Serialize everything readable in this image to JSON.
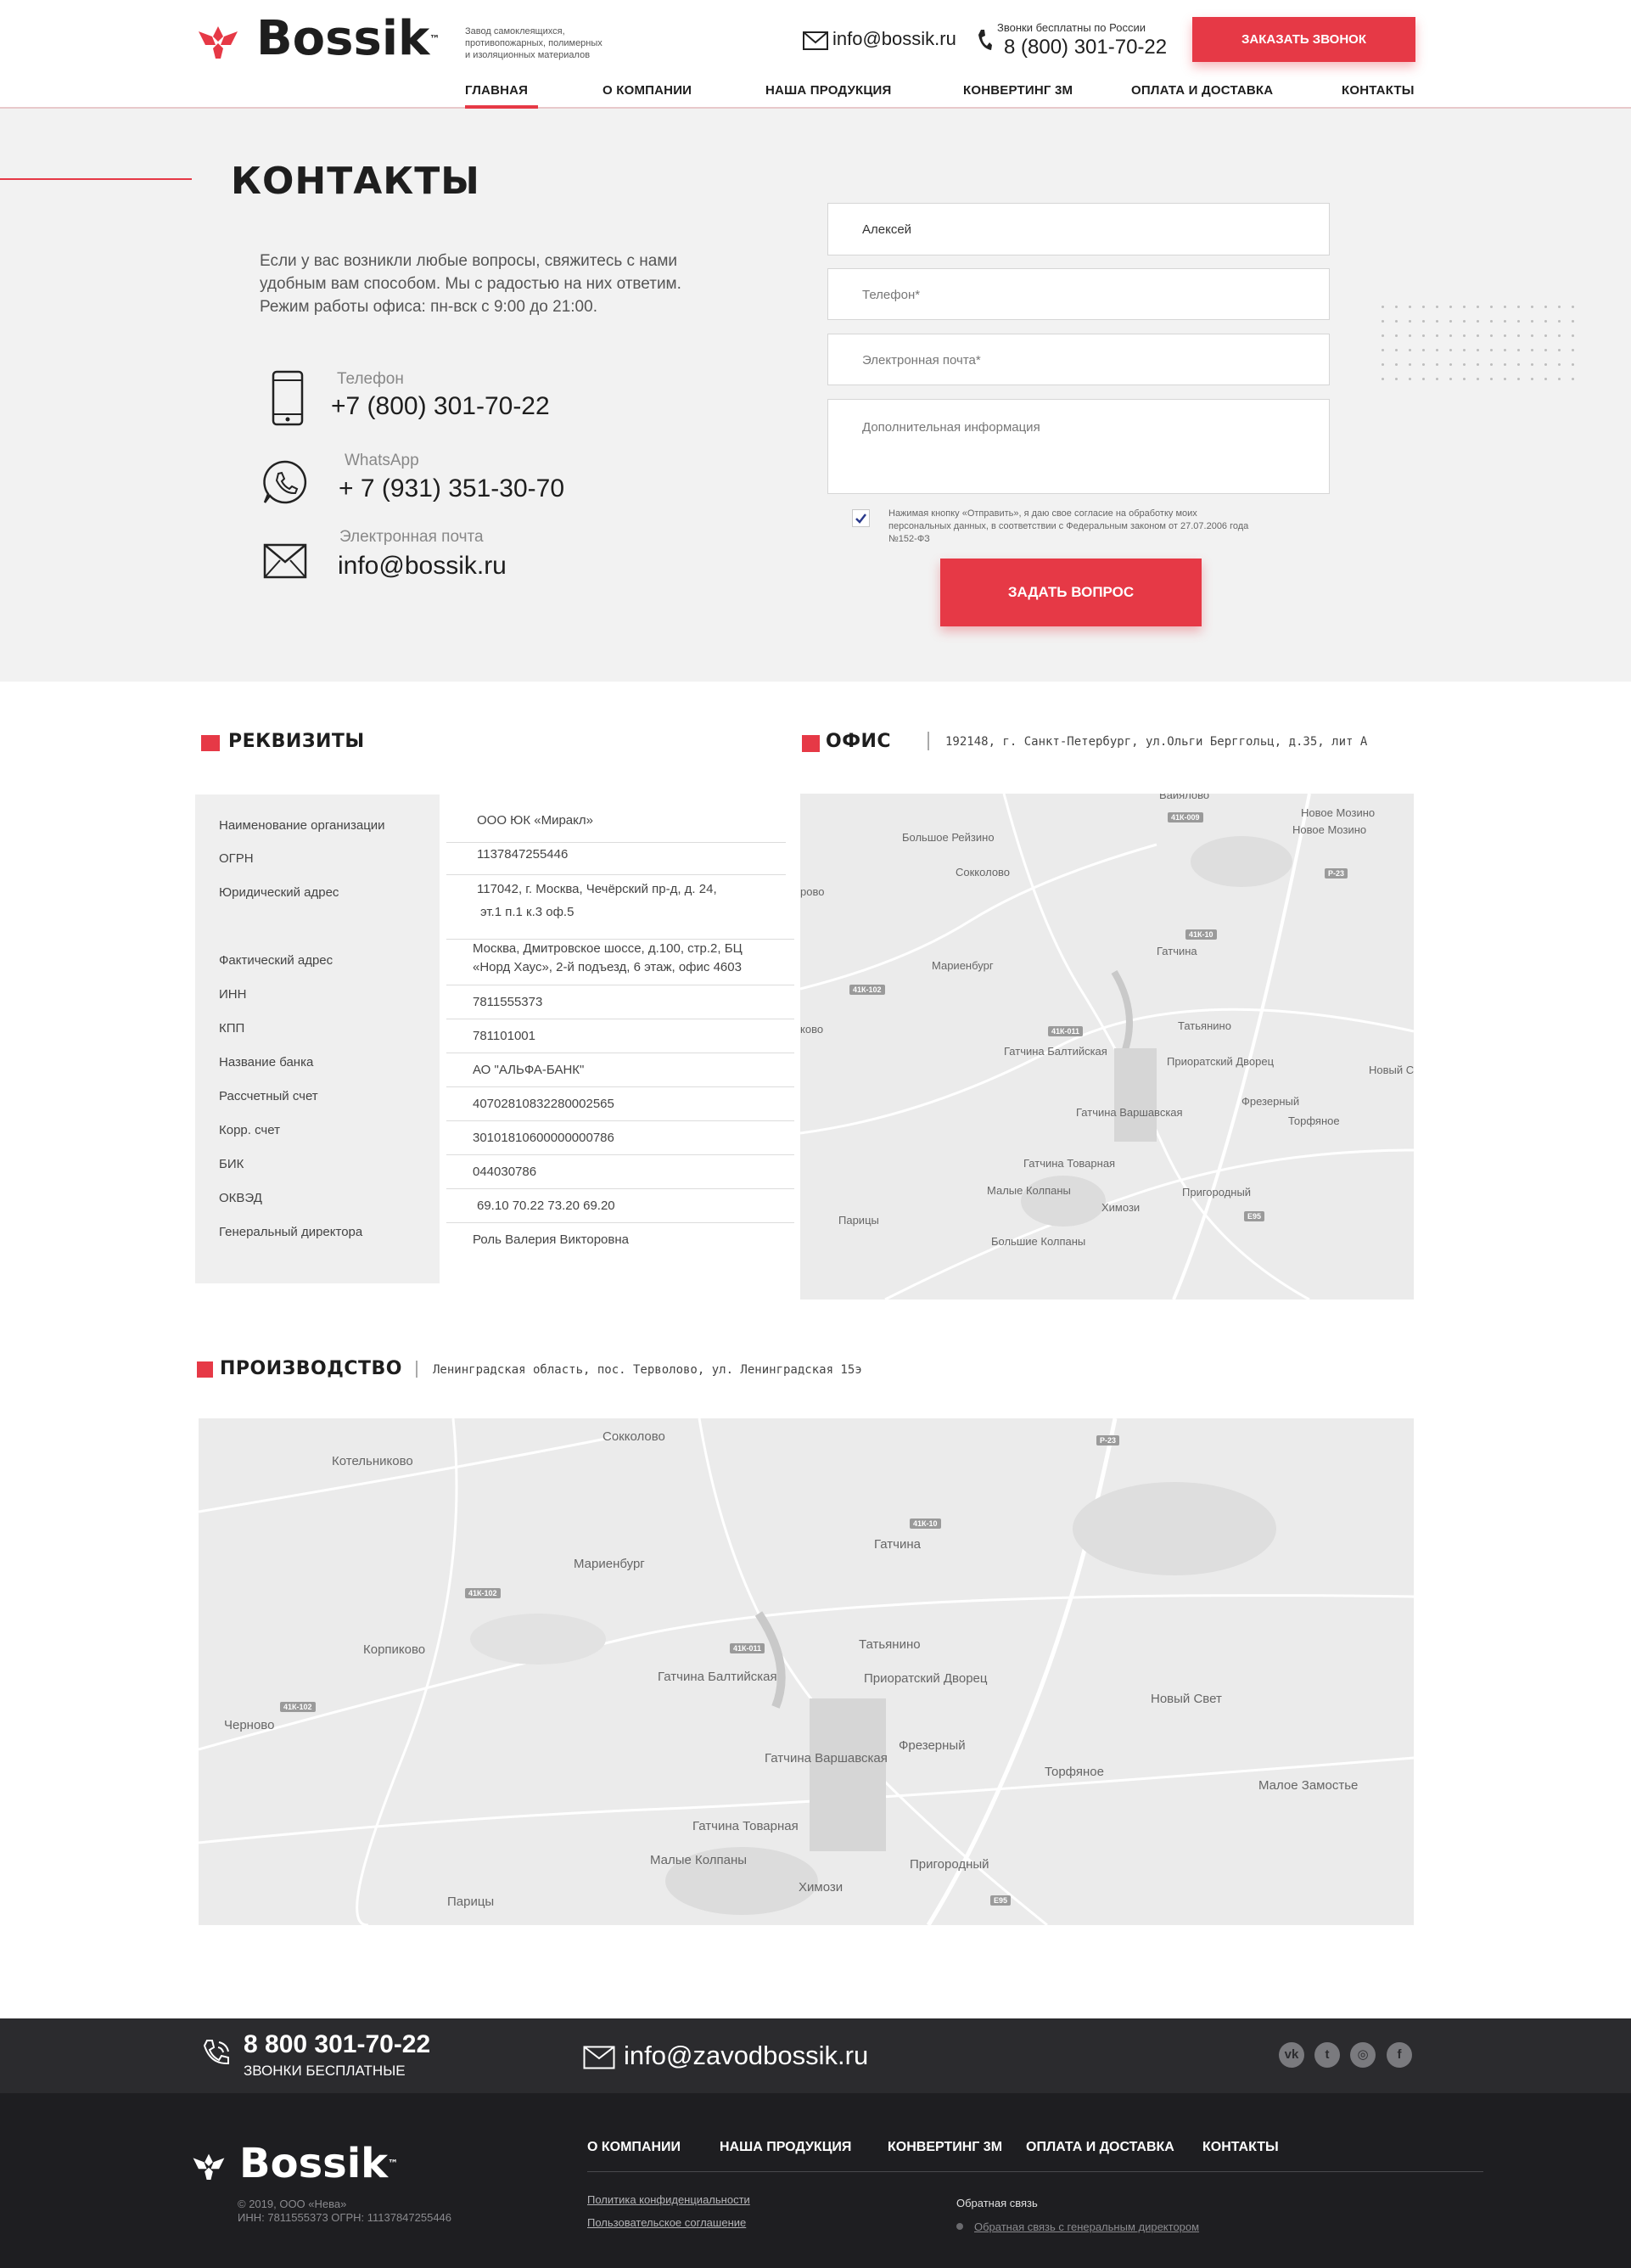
{
  "header": {
    "logo_text": "Bossik",
    "logo_tm": "™",
    "tagline": [
      "Завод самоклеящихся,",
      "противопожарных, полимерных",
      "и изоляционных материалов"
    ],
    "email": "info@bossik.ru",
    "phone_caption": "Звонки бесплатны по России",
    "phone": "8 (800) 301-70-22",
    "callback_button": "ЗАКАЗАТЬ ЗВОНОК",
    "nav": [
      "ГЛАВНАЯ",
      "О КОМПАНИИ",
      "НАША ПРОДУКЦИЯ",
      "КОНВЕРТИНГ 3М",
      "ОПЛАТА И ДОСТАВКА",
      "КОНТАКТЫ"
    ]
  },
  "contacts": {
    "title": "КОНТАКТЫ",
    "intro": [
      "Если у вас возникли любые вопросы, свяжитесь с нами",
      "удобным вам способом. Мы с радостью на них ответим.",
      "Режим работы офиса: пн-вск с 9:00 до 21:00."
    ],
    "items": [
      {
        "label": "Телефон",
        "value": "+7 (800) 301-70-22",
        "icon": "phone-icon"
      },
      {
        "label": "WhatsApp",
        "value": "+ 7 (931) 351-30-70",
        "icon": "whatsapp-icon"
      },
      {
        "label": "Электронная почта",
        "value": "info@bossik.ru",
        "icon": "mail-icon"
      }
    ]
  },
  "form": {
    "name_value": "Алексей",
    "phone_placeholder": "Телефон*",
    "email_placeholder": "Электронная почта*",
    "info_placeholder": "Дополнительная информация",
    "consent_checked": true,
    "consent_text": [
      "Нажимая кнопку «Отправить», я даю свое согласие на обработку моих",
      "персональных данных, в соответствии с Федеральным законом от 27.07.2006 года",
      "№152-ФЗ"
    ],
    "submit": "ЗАДАТЬ ВОПРОС"
  },
  "requisites": {
    "title": "РЕКВИЗИТЫ",
    "rows": [
      {
        "label": "Наименование организации",
        "value": [
          "ООО ЮК «Миракл»"
        ]
      },
      {
        "label": "ОГРН",
        "value": [
          "1137847255446"
        ]
      },
      {
        "label": "Юридический адрес",
        "value": [
          "117042, г. Москва, Чечёрский пр-д, д. 24,",
          "эт.1 п.1 к.3 оф.5"
        ]
      },
      {
        "label": "Фактический адрес",
        "value": [
          "Москва, Дмитровское шоссе, д.100, стр.2, БЦ",
          "«Норд Хаус», 2-й подъезд, 6 этаж, офис 4603"
        ]
      },
      {
        "label": "ИНН",
        "value": [
          "7811555373"
        ]
      },
      {
        "label": "КПП",
        "value": [
          "781101001"
        ]
      },
      {
        "label": "Название банка",
        "value": [
          "АО \"АЛЬФА-БАНК\""
        ]
      },
      {
        "label": "Рассчетный счет",
        "value": [
          "40702810832280002565"
        ]
      },
      {
        "label": "Корр. счет",
        "value": [
          "30101810600000000786"
        ]
      },
      {
        "label": "БИК",
        "value": [
          "044030786"
        ]
      },
      {
        "label": "ОКВЭД",
        "value": [
          "69.10 70.22 73.20 69.20"
        ]
      },
      {
        "label": "Генеральный директора",
        "value": [
          "Роль Валерия Викторовна"
        ]
      }
    ]
  },
  "office": {
    "title": "ОФИС",
    "address": "192148, г. Санкт-Петербург, ул.Ольги Берггольц, д.35, лит А",
    "map_labels": [
      "Вайялово",
      "Большое Рейзино",
      "Сокколово",
      "Новое Мозино",
      "Новое Мозино",
      "Мариенбург",
      "Гатчина",
      "Татьянино",
      "Гатчина Балтийская",
      "Приоратский Дворец",
      "Новый Св",
      "Фрезерный",
      "Гатчина Варшавская",
      "Торфяное",
      "Гатчина Товарная",
      "Малые Колпаны",
      "Химози",
      "Пригородный",
      "Парицы",
      "Большие Колпаны",
      "ково",
      "рово"
    ],
    "road_labels": [
      "41К-009",
      "Р-23",
      "41К-10",
      "41К-102",
      "41К-011",
      "Е95"
    ]
  },
  "production": {
    "title": "ПРОИЗВОДСТВО",
    "address": "Ленинградская область, пос. Терволово, ул. Ленинградская 15э",
    "map_labels": [
      "Сокколово",
      "Котельниково",
      "Мариенбург",
      "Гатчина",
      "Корпиково",
      "Татьянино",
      "Гатчина Балтийская",
      "Приоратский Дворец",
      "Новый Свет",
      "Черново",
      "Фрезерный",
      "Гатчина Варшавская",
      "Торфяное",
      "Малое Замостье",
      "Гатчина Товарная",
      "Малые Колпаны",
      "Пригородный",
      "Химози",
      "Парицы"
    ],
    "road_labels": [
      "Р-23",
      "41К-10",
      "41К-102",
      "41К-011",
      "41К-102",
      "Е95"
    ]
  },
  "footer": {
    "phone": "8 800 301-70-22",
    "phone_caption": "ЗВОНКИ БЕСПЛАТНЫЕ",
    "email": "info@zavodbossik.ru",
    "social": [
      "vk-icon",
      "twitter-icon",
      "instagram-icon",
      "facebook-icon"
    ],
    "logo_text": "Bossik",
    "logo_tm": "™",
    "copyright": "© 2019, ООО «Нева»",
    "legal": "ИНН: 7811555373 ОГРН: 11137847255446",
    "nav": [
      "О КОМПАНИИ",
      "НАША ПРОДУКЦИЯ",
      "КОНВЕРТИНГ 3М",
      "ОПЛАТА И ДОСТАВКА",
      "КОНТАКТЫ"
    ],
    "privacy": "Политика конфиденциальности",
    "agreement": "Пользовательское соглашение",
    "feedback_title": "Обратная связь",
    "feedback_link": "Обратная связь с генеральным директором"
  },
  "colors": {
    "accent": "#e63946",
    "dark": "#1e1e21",
    "footer_top": "#2b2b2e",
    "hero_bg": "#f2f2f2"
  }
}
